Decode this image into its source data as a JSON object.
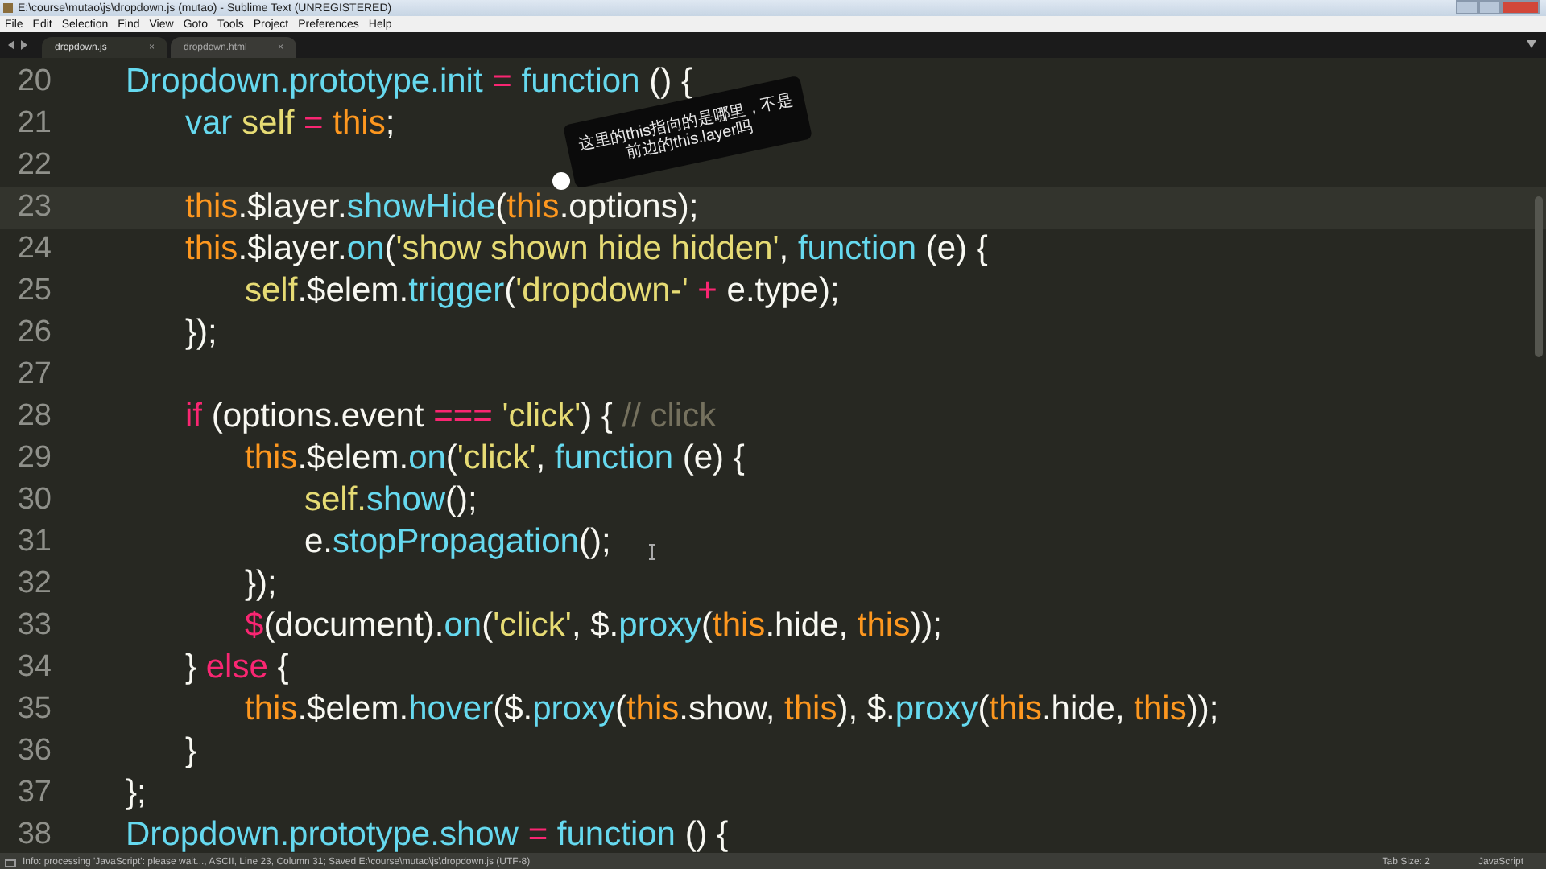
{
  "window": {
    "title": "E:\\course\\mutao\\js\\dropdown.js (mutao) - Sublime Text (UNREGISTERED)"
  },
  "menu": [
    "File",
    "Edit",
    "Selection",
    "Find",
    "View",
    "Goto",
    "Tools",
    "Project",
    "Preferences",
    "Help"
  ],
  "tabs": [
    {
      "label": "dropdown.js",
      "close": "×",
      "selected": true
    },
    {
      "label": "dropdown.html",
      "close": "×",
      "selected": false
    }
  ],
  "editor": {
    "lines": [
      {
        "number": "20",
        "current": false,
        "tokens": [
          {
            "kind": "fn",
            "text": "Dropdown.prototype.init"
          },
          {
            "kind": "op",
            "text": " = "
          },
          {
            "kind": "kw",
            "text": "function"
          },
          {
            "kind": "plain",
            "text": " () {"
          }
        ]
      },
      {
        "number": "21",
        "current": false,
        "tokens": [
          {
            "kind": "kw",
            "text": "\tvar"
          },
          {
            "kind": "var",
            "text": " self"
          },
          {
            "kind": "op",
            "text": " = "
          },
          {
            "kind": "this",
            "text": "this"
          },
          {
            "kind": "plain",
            "text": ";"
          }
        ]
      },
      {
        "number": "22",
        "current": false
      },
      {
        "number": "23",
        "current": true,
        "tokens": [
          {
            "kind": "this",
            "text": "\tthis"
          },
          {
            "kind": "plain",
            "text": ".$layer."
          },
          {
            "kind": "fn",
            "text": "showHide"
          },
          {
            "kind": "plain",
            "text": "("
          },
          {
            "kind": "this",
            "text": "this"
          },
          {
            "kind": "plain",
            "text": ".options);"
          }
        ]
      },
      {
        "number": "24",
        "current": false,
        "tokens": [
          {
            "kind": "this",
            "text": "\tthis"
          },
          {
            "kind": "plain",
            "text": ".$layer."
          },
          {
            "kind": "fn",
            "text": "on"
          },
          {
            "kind": "plain",
            "text": "("
          },
          {
            "kind": "str",
            "text": "'show shown hide hidden'"
          },
          {
            "kind": "plain",
            "text": ", "
          },
          {
            "kind": "kw",
            "text": "function"
          },
          {
            "kind": "plain",
            "text": " (e) {"
          }
        ]
      },
      {
        "number": "25",
        "current": false,
        "tokens": [
          {
            "kind": "var",
            "text": "\t\tself"
          },
          {
            "kind": "plain",
            "text": ".$elem."
          },
          {
            "kind": "fn",
            "text": "trigger"
          },
          {
            "kind": "plain",
            "text": "("
          },
          {
            "kind": "str",
            "text": "'dropdown-'"
          },
          {
            "kind": "op",
            "text": " + "
          },
          {
            "kind": "plain",
            "text": "e.type);"
          }
        ]
      },
      {
        "number": "26",
        "current": false,
        "tokens": [
          {
            "kind": "plain",
            "text": "\t});"
          }
        ]
      },
      {
        "number": "27",
        "current": false
      },
      {
        "number": "28",
        "current": false,
        "tokens": [
          {
            "kind": "op",
            "text": "\tif"
          },
          {
            "kind": "plain",
            "text": " (options.event "
          },
          {
            "kind": "op",
            "text": "==="
          },
          {
            "kind": "str",
            "text": " 'click'"
          },
          {
            "kind": "plain",
            "text": ") { "
          },
          {
            "kind": "cm",
            "text": "// click"
          }
        ]
      },
      {
        "number": "29",
        "current": false,
        "tokens": [
          {
            "kind": "this",
            "text": "\t\tthis"
          },
          {
            "kind": "plain",
            "text": ".$elem."
          },
          {
            "kind": "fn",
            "text": "on"
          },
          {
            "kind": "plain",
            "text": "("
          },
          {
            "kind": "str",
            "text": "'click'"
          },
          {
            "kind": "plain",
            "text": ", "
          },
          {
            "kind": "kw",
            "text": "function"
          },
          {
            "kind": "plain",
            "text": " (e) {"
          }
        ]
      },
      {
        "number": "30",
        "current": false,
        "tokens": [
          {
            "kind": "var",
            "text": "\t\t\tself."
          },
          {
            "kind": "fn",
            "text": "show"
          },
          {
            "kind": "plain",
            "text": "();"
          }
        ]
      },
      {
        "number": "31",
        "current": false,
        "tokens": [
          {
            "kind": "plain",
            "text": "\t\t\te."
          },
          {
            "kind": "fn",
            "text": "stopPropagation"
          },
          {
            "kind": "plain",
            "text": "();"
          }
        ]
      },
      {
        "number": "32",
        "current": false,
        "tokens": [
          {
            "kind": "plain",
            "text": "\t\t});"
          }
        ]
      },
      {
        "number": "33",
        "current": false,
        "tokens": [
          {
            "kind": "op",
            "text": "\t\t$"
          },
          {
            "kind": "plain",
            "text": "(document)."
          },
          {
            "kind": "fn",
            "text": "on"
          },
          {
            "kind": "plain",
            "text": "("
          },
          {
            "kind": "str",
            "text": "'click'"
          },
          {
            "kind": "plain",
            "text": ", $."
          },
          {
            "kind": "fn",
            "text": "proxy"
          },
          {
            "kind": "plain",
            "text": "("
          },
          {
            "kind": "this",
            "text": "this"
          },
          {
            "kind": "plain",
            "text": ".hide, "
          },
          {
            "kind": "this",
            "text": "this"
          },
          {
            "kind": "plain",
            "text": "));"
          }
        ]
      },
      {
        "number": "34",
        "current": false,
        "tokens": [
          {
            "kind": "plain",
            "text": "\t} "
          },
          {
            "kind": "op",
            "text": "else"
          },
          {
            "kind": "plain",
            "text": " {"
          }
        ]
      },
      {
        "number": "35",
        "current": false,
        "tokens": [
          {
            "kind": "this",
            "text": "\t\tthis"
          },
          {
            "kind": "plain",
            "text": ".$elem."
          },
          {
            "kind": "fn",
            "text": "hover"
          },
          {
            "kind": "plain",
            "text": "($."
          },
          {
            "kind": "fn",
            "text": "proxy"
          },
          {
            "kind": "plain",
            "text": "("
          },
          {
            "kind": "this",
            "text": "this"
          },
          {
            "kind": "plain",
            "text": ".show, "
          },
          {
            "kind": "this",
            "text": "this"
          },
          {
            "kind": "plain",
            "text": "), $."
          },
          {
            "kind": "fn",
            "text": "proxy"
          },
          {
            "kind": "plain",
            "text": "("
          },
          {
            "kind": "this",
            "text": "this"
          },
          {
            "kind": "plain",
            "text": ".hide, "
          },
          {
            "kind": "this",
            "text": "this"
          },
          {
            "kind": "plain",
            "text": "));"
          }
        ]
      },
      {
        "number": "36",
        "current": false,
        "tokens": [
          {
            "kind": "plain",
            "text": "\t}"
          }
        ]
      },
      {
        "number": "37",
        "current": false,
        "tokens": [
          {
            "kind": "plain",
            "text": "};"
          }
        ]
      },
      {
        "number": "38",
        "current": false,
        "tokens": [
          {
            "kind": "fn",
            "text": "Dropdown.prototype.show"
          },
          {
            "kind": "op",
            "text": " = "
          },
          {
            "kind": "kw",
            "text": "function"
          },
          {
            "kind": "plain",
            "text": " () {"
          }
        ]
      }
    ]
  },
  "annotation": {
    "text": "这里的this指向的是哪里，不是前边的this.layer吗"
  },
  "status_bar": {
    "message": "Info: processing 'JavaScript': please wait..., ASCII, Line 23, Column 31; Saved E:\\course\\mutao\\js\\dropdown.js (UTF-8)",
    "tab_size": "Tab Size: 2",
    "syntax": "JavaScript"
  }
}
